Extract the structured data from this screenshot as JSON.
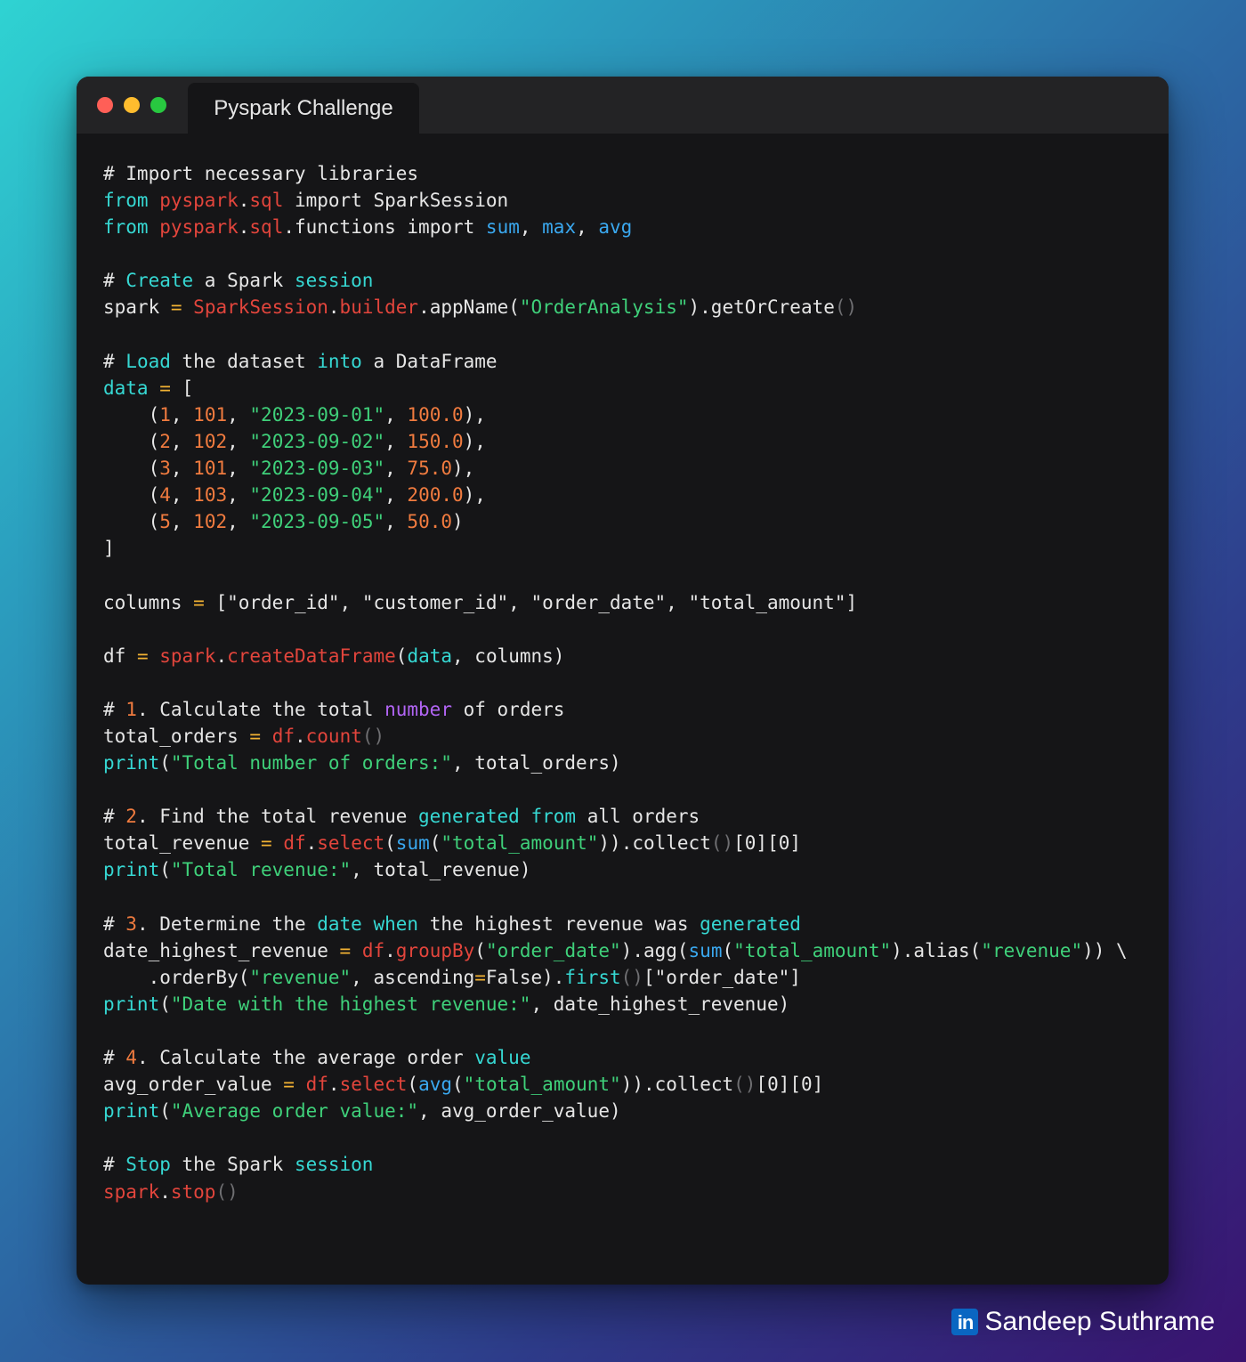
{
  "window": {
    "tab_title": "Pyspark Challenge"
  },
  "code_lines": [
    [
      [
        "c",
        "# Import necessary libraries"
      ]
    ],
    [
      [
        "cy",
        "from"
      ],
      [
        "c",
        " "
      ],
      [
        "r",
        "pyspark"
      ],
      [
        "c",
        "."
      ],
      [
        "r",
        "sql"
      ],
      [
        "c",
        " import SparkSession"
      ]
    ],
    [
      [
        "cy",
        "from"
      ],
      [
        "c",
        " "
      ],
      [
        "r",
        "pyspark"
      ],
      [
        "c",
        "."
      ],
      [
        "r",
        "sql"
      ],
      [
        "c",
        ".functions import "
      ],
      [
        "b",
        "sum"
      ],
      [
        "c",
        ", "
      ],
      [
        "b",
        "max"
      ],
      [
        "c",
        ", "
      ],
      [
        "b",
        "avg"
      ]
    ],
    [],
    [
      [
        "c",
        "# "
      ],
      [
        "cy",
        "Create"
      ],
      [
        "c",
        " a Spark "
      ],
      [
        "cy",
        "session"
      ]
    ],
    [
      [
        "c",
        "spark "
      ],
      [
        "y",
        "="
      ],
      [
        "c",
        " "
      ],
      [
        "r",
        "SparkSession"
      ],
      [
        "c",
        "."
      ],
      [
        "r",
        "builder"
      ],
      [
        "c",
        ".appName("
      ],
      [
        "g",
        "\"OrderAnalysis\""
      ],
      [
        "c",
        ").getOrCreate"
      ],
      [
        "gr",
        "()"
      ]
    ],
    [],
    [
      [
        "c",
        "# "
      ],
      [
        "cy",
        "Load"
      ],
      [
        "c",
        " the dataset "
      ],
      [
        "cy",
        "into"
      ],
      [
        "c",
        " a DataFrame"
      ]
    ],
    [
      [
        "cy",
        "data"
      ],
      [
        "c",
        " "
      ],
      [
        "y",
        "="
      ],
      [
        "c",
        " ["
      ]
    ],
    [
      [
        "c",
        "    ("
      ],
      [
        "o",
        "1"
      ],
      [
        "c",
        ", "
      ],
      [
        "o",
        "101"
      ],
      [
        "c",
        ", "
      ],
      [
        "g",
        "\"2023-09-01\""
      ],
      [
        "c",
        ", "
      ],
      [
        "o",
        "100.0"
      ],
      [
        "c",
        "),"
      ]
    ],
    [
      [
        "c",
        "    ("
      ],
      [
        "o",
        "2"
      ],
      [
        "c",
        ", "
      ],
      [
        "o",
        "102"
      ],
      [
        "c",
        ", "
      ],
      [
        "g",
        "\"2023-09-02\""
      ],
      [
        "c",
        ", "
      ],
      [
        "o",
        "150.0"
      ],
      [
        "c",
        "),"
      ]
    ],
    [
      [
        "c",
        "    ("
      ],
      [
        "o",
        "3"
      ],
      [
        "c",
        ", "
      ],
      [
        "o",
        "101"
      ],
      [
        "c",
        ", "
      ],
      [
        "g",
        "\"2023-09-03\""
      ],
      [
        "c",
        ", "
      ],
      [
        "o",
        "75.0"
      ],
      [
        "c",
        "),"
      ]
    ],
    [
      [
        "c",
        "    ("
      ],
      [
        "o",
        "4"
      ],
      [
        "c",
        ", "
      ],
      [
        "o",
        "103"
      ],
      [
        "c",
        ", "
      ],
      [
        "g",
        "\"2023-09-04\""
      ],
      [
        "c",
        ", "
      ],
      [
        "o",
        "200.0"
      ],
      [
        "c",
        "),"
      ]
    ],
    [
      [
        "c",
        "    ("
      ],
      [
        "o",
        "5"
      ],
      [
        "c",
        ", "
      ],
      [
        "o",
        "102"
      ],
      [
        "c",
        ", "
      ],
      [
        "g",
        "\"2023-09-05\""
      ],
      [
        "c",
        ", "
      ],
      [
        "o",
        "50.0"
      ],
      [
        "c",
        ")"
      ]
    ],
    [
      [
        "c",
        "]"
      ]
    ],
    [],
    [
      [
        "c",
        "columns "
      ],
      [
        "y",
        "="
      ],
      [
        "c",
        " [\"order_id\", \"customer_id\", \"order_date\", \"total_amount\"]"
      ]
    ],
    [],
    [
      [
        "c",
        "df "
      ],
      [
        "y",
        "="
      ],
      [
        "c",
        " "
      ],
      [
        "r",
        "spark"
      ],
      [
        "c",
        "."
      ],
      [
        "r",
        "createDataFrame"
      ],
      [
        "c",
        "("
      ],
      [
        "cy",
        "data"
      ],
      [
        "c",
        ", columns)"
      ]
    ],
    [],
    [
      [
        "c",
        "# "
      ],
      [
        "o",
        "1"
      ],
      [
        "c",
        ". Calculate the total "
      ],
      [
        "p",
        "number"
      ],
      [
        "c",
        " of orders"
      ]
    ],
    [
      [
        "c",
        "total_orders "
      ],
      [
        "y",
        "="
      ],
      [
        "c",
        " "
      ],
      [
        "r",
        "df"
      ],
      [
        "c",
        "."
      ],
      [
        "r",
        "count"
      ],
      [
        "gr",
        "()"
      ]
    ],
    [
      [
        "cy",
        "print"
      ],
      [
        "c",
        "("
      ],
      [
        "g",
        "\"Total number of orders:\""
      ],
      [
        "c",
        ", total_orders)"
      ]
    ],
    [],
    [
      [
        "c",
        "# "
      ],
      [
        "o",
        "2"
      ],
      [
        "c",
        ". Find the total revenue "
      ],
      [
        "cy",
        "generated"
      ],
      [
        "c",
        " "
      ],
      [
        "cy",
        "from"
      ],
      [
        "c",
        " all orders"
      ]
    ],
    [
      [
        "c",
        "total_revenue "
      ],
      [
        "y",
        "="
      ],
      [
        "c",
        " "
      ],
      [
        "r",
        "df"
      ],
      [
        "c",
        "."
      ],
      [
        "r",
        "select"
      ],
      [
        "c",
        "("
      ],
      [
        "b",
        "sum"
      ],
      [
        "c",
        "("
      ],
      [
        "g",
        "\"total_amount\""
      ],
      [
        "c",
        ")).collect"
      ],
      [
        "gr",
        "()"
      ],
      [
        "c",
        "[0][0]"
      ]
    ],
    [
      [
        "cy",
        "print"
      ],
      [
        "c",
        "("
      ],
      [
        "g",
        "\"Total revenue:\""
      ],
      [
        "c",
        ", total_revenue)"
      ]
    ],
    [],
    [
      [
        "c",
        "# "
      ],
      [
        "o",
        "3"
      ],
      [
        "c",
        ". Determine the "
      ],
      [
        "cy",
        "date"
      ],
      [
        "c",
        " "
      ],
      [
        "cy",
        "when"
      ],
      [
        "c",
        " the highest revenue was "
      ],
      [
        "cy",
        "generated"
      ]
    ],
    [
      [
        "c",
        "date_highest_revenue "
      ],
      [
        "y",
        "="
      ],
      [
        "c",
        " "
      ],
      [
        "r",
        "df"
      ],
      [
        "c",
        "."
      ],
      [
        "r",
        "groupBy"
      ],
      [
        "c",
        "("
      ],
      [
        "g",
        "\"order_date\""
      ],
      [
        "c",
        ").agg("
      ],
      [
        "b",
        "sum"
      ],
      [
        "c",
        "("
      ],
      [
        "g",
        "\"total_amount\""
      ],
      [
        "c",
        ").alias("
      ],
      [
        "g",
        "\"revenue\""
      ],
      [
        "c",
        ")) \\"
      ]
    ],
    [
      [
        "c",
        "    .orderBy("
      ],
      [
        "g",
        "\"revenue\""
      ],
      [
        "c",
        ", ascending"
      ],
      [
        "y",
        "="
      ],
      [
        "c",
        "False)."
      ],
      [
        "cy",
        "first"
      ],
      [
        "gr",
        "()"
      ],
      [
        "c",
        "[\"order_date\"]"
      ]
    ],
    [
      [
        "cy",
        "print"
      ],
      [
        "c",
        "("
      ],
      [
        "g",
        "\"Date with the highest revenue:\""
      ],
      [
        "c",
        ", date_highest_revenue)"
      ]
    ],
    [],
    [
      [
        "c",
        "# "
      ],
      [
        "o",
        "4"
      ],
      [
        "c",
        ". Calculate the average order "
      ],
      [
        "cy",
        "value"
      ]
    ],
    [
      [
        "c",
        "avg_order_value "
      ],
      [
        "y",
        "="
      ],
      [
        "c",
        " "
      ],
      [
        "r",
        "df"
      ],
      [
        "c",
        "."
      ],
      [
        "r",
        "select"
      ],
      [
        "c",
        "("
      ],
      [
        "b",
        "avg"
      ],
      [
        "c",
        "("
      ],
      [
        "g",
        "\"total_amount\""
      ],
      [
        "c",
        ")).collect"
      ],
      [
        "gr",
        "()"
      ],
      [
        "c",
        "[0][0]"
      ]
    ],
    [
      [
        "cy",
        "print"
      ],
      [
        "c",
        "("
      ],
      [
        "g",
        "\"Average order value:\""
      ],
      [
        "c",
        ", avg_order_value)"
      ]
    ],
    [],
    [
      [
        "c",
        "# "
      ],
      [
        "cy",
        "Stop"
      ],
      [
        "c",
        " the Spark "
      ],
      [
        "cy",
        "session"
      ]
    ],
    [
      [
        "r",
        "spark"
      ],
      [
        "c",
        "."
      ],
      [
        "r",
        "stop"
      ],
      [
        "gr",
        "()"
      ]
    ]
  ],
  "brand": {
    "icon_name": "linkedin-icon",
    "icon_text": "in",
    "author": "Sandeep Suthrame"
  },
  "colors": {
    "window_bg": "#151517",
    "titlebar_bg": "#232325",
    "text": "#e6e6e6",
    "cyan": "#36d8d3",
    "red": "#e2453c",
    "green": "#3fd07a",
    "orange": "#f07b3f",
    "blue": "#3aa8ef",
    "purple": "#b265f5",
    "linkedin_blue": "#0a66c2"
  }
}
